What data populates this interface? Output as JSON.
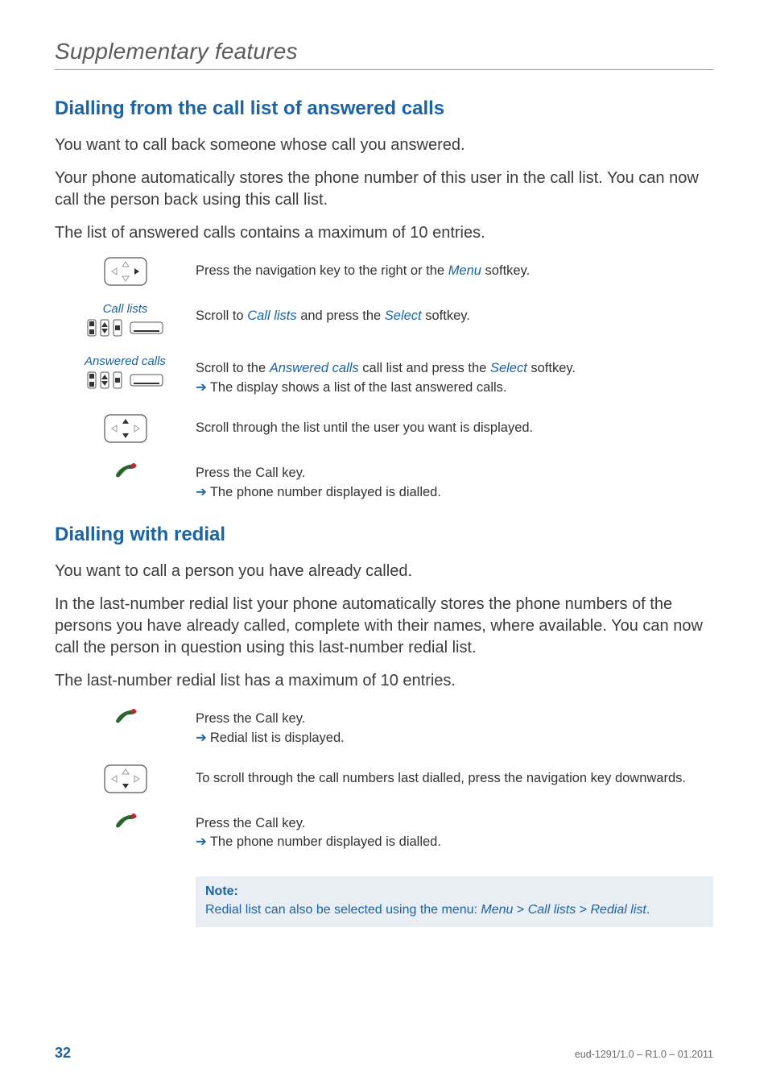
{
  "runningHead": "Supplementary features",
  "sections": {
    "answered": {
      "title": "Dialling from the call list of answered calls",
      "paras": [
        "You want to call back someone whose call you answered.",
        "Your phone automatically stores the phone number of this user in the call list. You can now call the person back using this call list.",
        "The list of answered calls contains a maximum of 10 entries."
      ],
      "steps": [
        {
          "iconCaption": "",
          "parts": [
            {
              "t": "Press the navigation key to the right or the "
            },
            {
              "t": "Menu",
              "em": true
            },
            {
              "t": " softkey."
            }
          ]
        },
        {
          "iconCaption": "Call lists",
          "parts": [
            {
              "t": "Scroll to "
            },
            {
              "t": "Call lists",
              "em": true
            },
            {
              "t": " and press the "
            },
            {
              "t": "Select",
              "em": true
            },
            {
              "t": " softkey."
            }
          ]
        },
        {
          "iconCaption": "Answered calls",
          "parts": [
            {
              "t": "Scroll to the "
            },
            {
              "t": "Answered calls",
              "em": true
            },
            {
              "t": " call list and press the "
            },
            {
              "t": "Select",
              "em": true
            },
            {
              "t": " softkey."
            }
          ],
          "arrowLine": "The display shows a list of the last answered calls."
        },
        {
          "iconCaption": "",
          "parts": [
            {
              "t": "Scroll through the list until the user you want is displayed."
            }
          ]
        },
        {
          "iconCaption": "",
          "parts": [
            {
              "t": "Press the Call key."
            }
          ],
          "arrowLine": "The phone number displayed is dialled."
        }
      ]
    },
    "redial": {
      "title": "Dialling with redial",
      "paras": [
        "You want to call a person you have already called.",
        "In the last-number redial list your phone automatically stores the phone numbers of the persons you have already called, complete with their names, where available. You can now call the person in question using this last-number redial list.",
        "The last-number redial list has a maximum of 10 entries."
      ],
      "steps": [
        {
          "iconCaption": "",
          "parts": [
            {
              "t": "Press the Call key."
            }
          ],
          "arrowLine": "Redial list is displayed."
        },
        {
          "iconCaption": "",
          "parts": [
            {
              "t": "To scroll through the call numbers last dialled, press the navigation key downwards."
            }
          ]
        },
        {
          "iconCaption": "",
          "parts": [
            {
              "t": "Press the Call key."
            }
          ],
          "arrowLine": "The phone number displayed is dialled."
        }
      ],
      "note": {
        "title": "Note:",
        "parts": [
          {
            "t": "Redial list can also be selected using the menu: "
          },
          {
            "t": "Menu",
            "em": true
          },
          {
            "t": " > "
          },
          {
            "t": "Call lists",
            "em": true
          },
          {
            "t": " > "
          },
          {
            "t": "Redial list",
            "em": true
          },
          {
            "t": "."
          }
        ]
      }
    }
  },
  "footer": {
    "pageNumber": "32",
    "docId": "eud-1291/1.0 – R1.0 – 01.2011"
  },
  "icons": {
    "navKey": "nav-key-icon",
    "scrollSelect": "scroll-select-icon",
    "callKey": "call-key-icon"
  }
}
